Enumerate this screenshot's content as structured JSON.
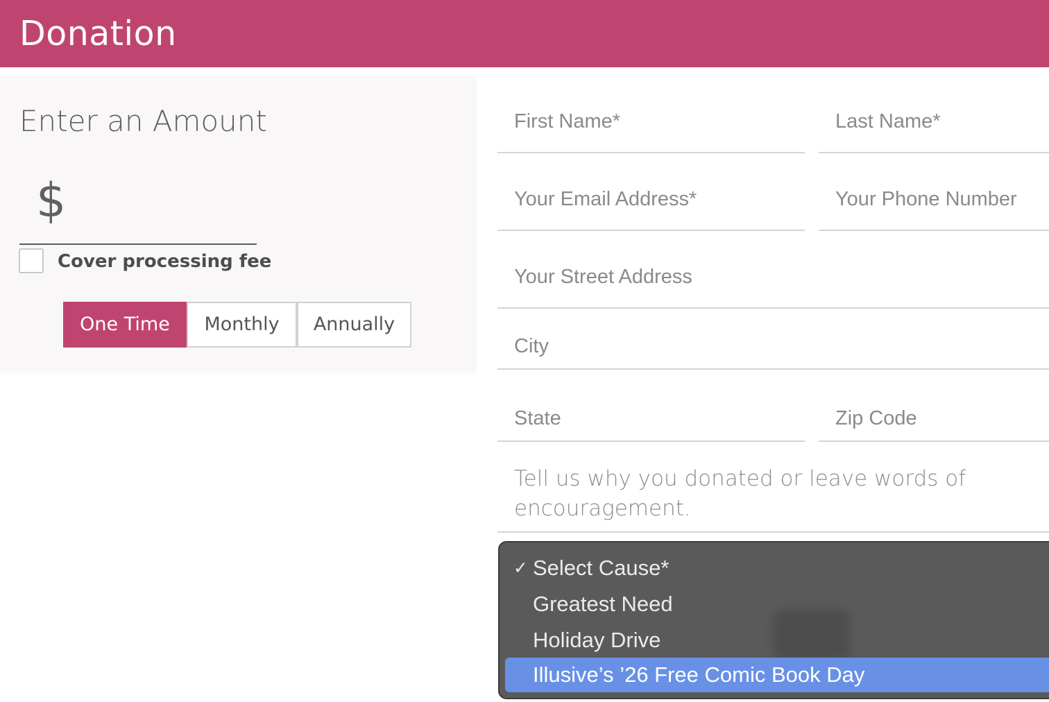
{
  "header": {
    "title": "Donation",
    "color": "#c04470"
  },
  "amount": {
    "heading": "Enter an Amount",
    "currency_symbol": "$",
    "value": "",
    "cover_fee_label": "Cover processing fee",
    "cover_fee_checked": false
  },
  "frequency": {
    "options": [
      "One Time",
      "Monthly",
      "Annually"
    ],
    "selected": "One Time"
  },
  "form": {
    "first_name_placeholder": "First Name*",
    "last_name_placeholder": "Last Name*",
    "email_placeholder": "Your Email Address*",
    "phone_placeholder": "Your Phone Number",
    "street_placeholder": "Your Street Address",
    "city_placeholder": "City",
    "state_placeholder": "State",
    "zip_placeholder": "Zip Code",
    "message_placeholder": "Tell us why you donated or leave words of encouragement."
  },
  "cause_dropdown": {
    "options": [
      {
        "label": "Select Cause*",
        "checked": true,
        "highlighted": false
      },
      {
        "label": "Greatest Need",
        "checked": false,
        "highlighted": false
      },
      {
        "label": "Holiday Drive",
        "checked": false,
        "highlighted": false
      },
      {
        "label": "Illusive’s ’26 Free Comic Book Day",
        "checked": false,
        "highlighted": true
      }
    ],
    "check_glyph": "✓",
    "highlight_color": "#6891e6"
  }
}
